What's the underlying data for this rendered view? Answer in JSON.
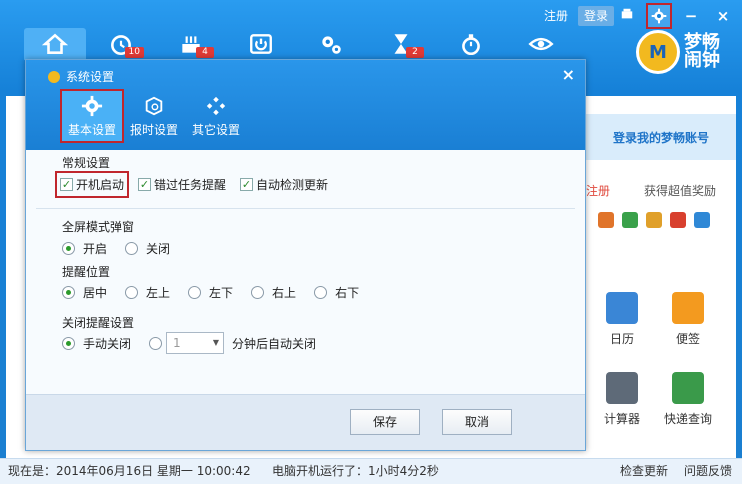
{
  "top_links": {
    "register": "注册",
    "login": "登录"
  },
  "window_controls": {
    "skin": "skin-icon",
    "settings": "gear-icon",
    "minimize": "−",
    "close": "×"
  },
  "toolbar": [
    {
      "icon": "home-icon",
      "badge": ""
    },
    {
      "icon": "alarm-icon",
      "badge": "10"
    },
    {
      "icon": "birthday-icon",
      "badge": "4"
    },
    {
      "icon": "power-icon",
      "badge": ""
    },
    {
      "icon": "gears-icon",
      "badge": ""
    },
    {
      "icon": "hourglass-icon",
      "badge": "2"
    },
    {
      "icon": "stopwatch-icon",
      "badge": ""
    },
    {
      "icon": "eye-icon",
      "badge": ""
    }
  ],
  "brand": {
    "name": "梦畅闹钟",
    "logo_letter": "M"
  },
  "right_panel": {
    "login_card": "登录我的梦畅账号",
    "register": "注册",
    "reward": "获得超值奖励",
    "tiles": [
      {
        "label": "日历",
        "color": "#3a86d6"
      },
      {
        "label": "便签",
        "color": "#f39a1f"
      },
      {
        "label": "计算器",
        "color": "#5e6a78"
      },
      {
        "label": "快递查询",
        "color": "#3a9a4a"
      }
    ]
  },
  "dialog": {
    "title": "系统设置",
    "close": "×",
    "tabs": [
      {
        "label": "基本设置",
        "icon": "gear-icon",
        "active": true
      },
      {
        "label": "报时设置",
        "icon": "cube-icon",
        "active": false
      },
      {
        "label": "其它设置",
        "icon": "diamonds-icon",
        "active": false
      }
    ],
    "general": {
      "title": "常规设置",
      "options": [
        {
          "label": "开机启动",
          "checked": true
        },
        {
          "label": "错过任务提醒",
          "checked": true
        },
        {
          "label": "自动检测更新",
          "checked": true
        }
      ]
    },
    "fullscreen": {
      "title": "全屏模式弹窗",
      "options": [
        {
          "label": "开启",
          "selected": true
        },
        {
          "label": "关闭",
          "selected": false
        }
      ]
    },
    "position": {
      "title": "提醒位置",
      "options": [
        {
          "label": "居中",
          "selected": true
        },
        {
          "label": "左上",
          "selected": false
        },
        {
          "label": "左下",
          "selected": false
        },
        {
          "label": "右上",
          "selected": false
        },
        {
          "label": "右下",
          "selected": false
        }
      ]
    },
    "close_setting": {
      "title": "关闭提醒设置",
      "manual": "手动关闭",
      "select_value": "1",
      "suffix": "分钟后自动关闭"
    },
    "buttons": {
      "save": "保存",
      "cancel": "取消"
    }
  },
  "status": {
    "now": "现在是：2014年06月16日  星期一  10:00:42",
    "uptime": "电脑开机运行了：1小时4分2秒",
    "check_update": "检查更新",
    "feedback": "问题反馈"
  }
}
